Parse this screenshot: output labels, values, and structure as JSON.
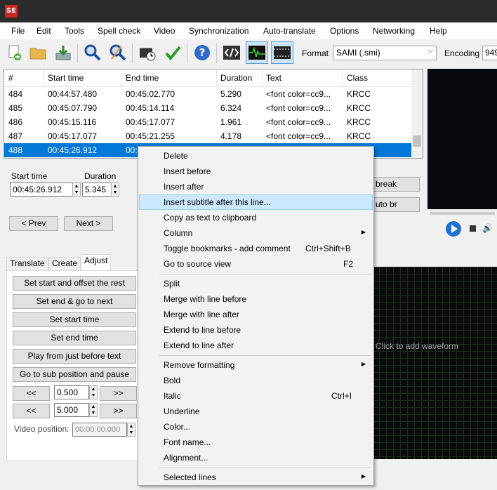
{
  "app": {
    "icon_text": "SE"
  },
  "menu": [
    "File",
    "Edit",
    "Tools",
    "Spell check",
    "Video",
    "Synchronization",
    "Auto-translate",
    "Options",
    "Networking",
    "Help"
  ],
  "toolbar": {
    "format_label": "Format",
    "format_value": "SAMI (.smi)",
    "encoding_label": "Encoding",
    "encoding_value": "949"
  },
  "grid": {
    "columns": [
      "#",
      "Start time",
      "End time",
      "Duration",
      "Text",
      "Class"
    ],
    "rows": [
      [
        "484",
        "00:44:57.480",
        "00:45:02.770",
        "5.290",
        "<font color=cc9...",
        "KRCC"
      ],
      [
        "485",
        "00:45:07.790",
        "00:45:14.114",
        "6.324",
        "<font color=cc9...",
        "KRCC"
      ],
      [
        "486",
        "00:45:15.116",
        "00:45:17.077",
        "1.961",
        "<font color=cc9...",
        "KRCC"
      ],
      [
        "487",
        "00:45:17.077",
        "00:45:21.255",
        "4.178",
        "<font color=cc9...",
        "KRCC"
      ],
      [
        "488",
        "00:45:26.912",
        "00:",
        "",
        "",
        ""
      ]
    ]
  },
  "editor": {
    "start_time_label": "Start time",
    "start_time_value": "00:45:26.912",
    "duration_label": "Duration",
    "duration_value": "5.345",
    "prev_button": "< Prev",
    "next_button": "Next >",
    "break_button": "break",
    "auto_br_button": "uto br"
  },
  "tabs": [
    "Translate",
    "Create",
    "Adjust"
  ],
  "adjust": {
    "buttons": [
      "Set start and offset the rest",
      "Set end & go to next",
      "Set start time",
      "Set end time",
      "Play from just before text",
      "Go to sub position and pause"
    ],
    "back_label": "<<",
    "fwd_label": ">>",
    "step1": "0.500",
    "step2": "5.000",
    "video_position_label": "Video position:",
    "video_position_value": "00:00:00.000"
  },
  "waveform": {
    "hint": "Click to add waveform"
  },
  "context_menu": {
    "items": [
      {
        "label": "Delete"
      },
      {
        "label": "Insert before"
      },
      {
        "label": "Insert after"
      },
      {
        "label": "Insert subtitle after this line..."
      },
      {
        "label": "Copy as text to clipboard"
      },
      {
        "label": "Column"
      },
      {
        "label": "Toggle bookmarks - add comment",
        "shortcut": "Ctrl+Shift+B"
      },
      {
        "label": "Go to source view",
        "shortcut": "F2"
      },
      {
        "label": "Split"
      },
      {
        "label": "Merge with line before"
      },
      {
        "label": "Merge with line after"
      },
      {
        "label": "Extend to line before"
      },
      {
        "label": "Extend to line after"
      },
      {
        "label": "Remove formatting"
      },
      {
        "label": "Bold"
      },
      {
        "label": "Italic",
        "shortcut": "Ctrl+I"
      },
      {
        "label": "Underline"
      },
      {
        "label": "Color..."
      },
      {
        "label": "Font name..."
      },
      {
        "label": "Alignment..."
      },
      {
        "label": "Selected lines"
      }
    ]
  },
  "colors": {
    "accent": "#0078d7",
    "menu_highlight": "#cce8ff"
  }
}
